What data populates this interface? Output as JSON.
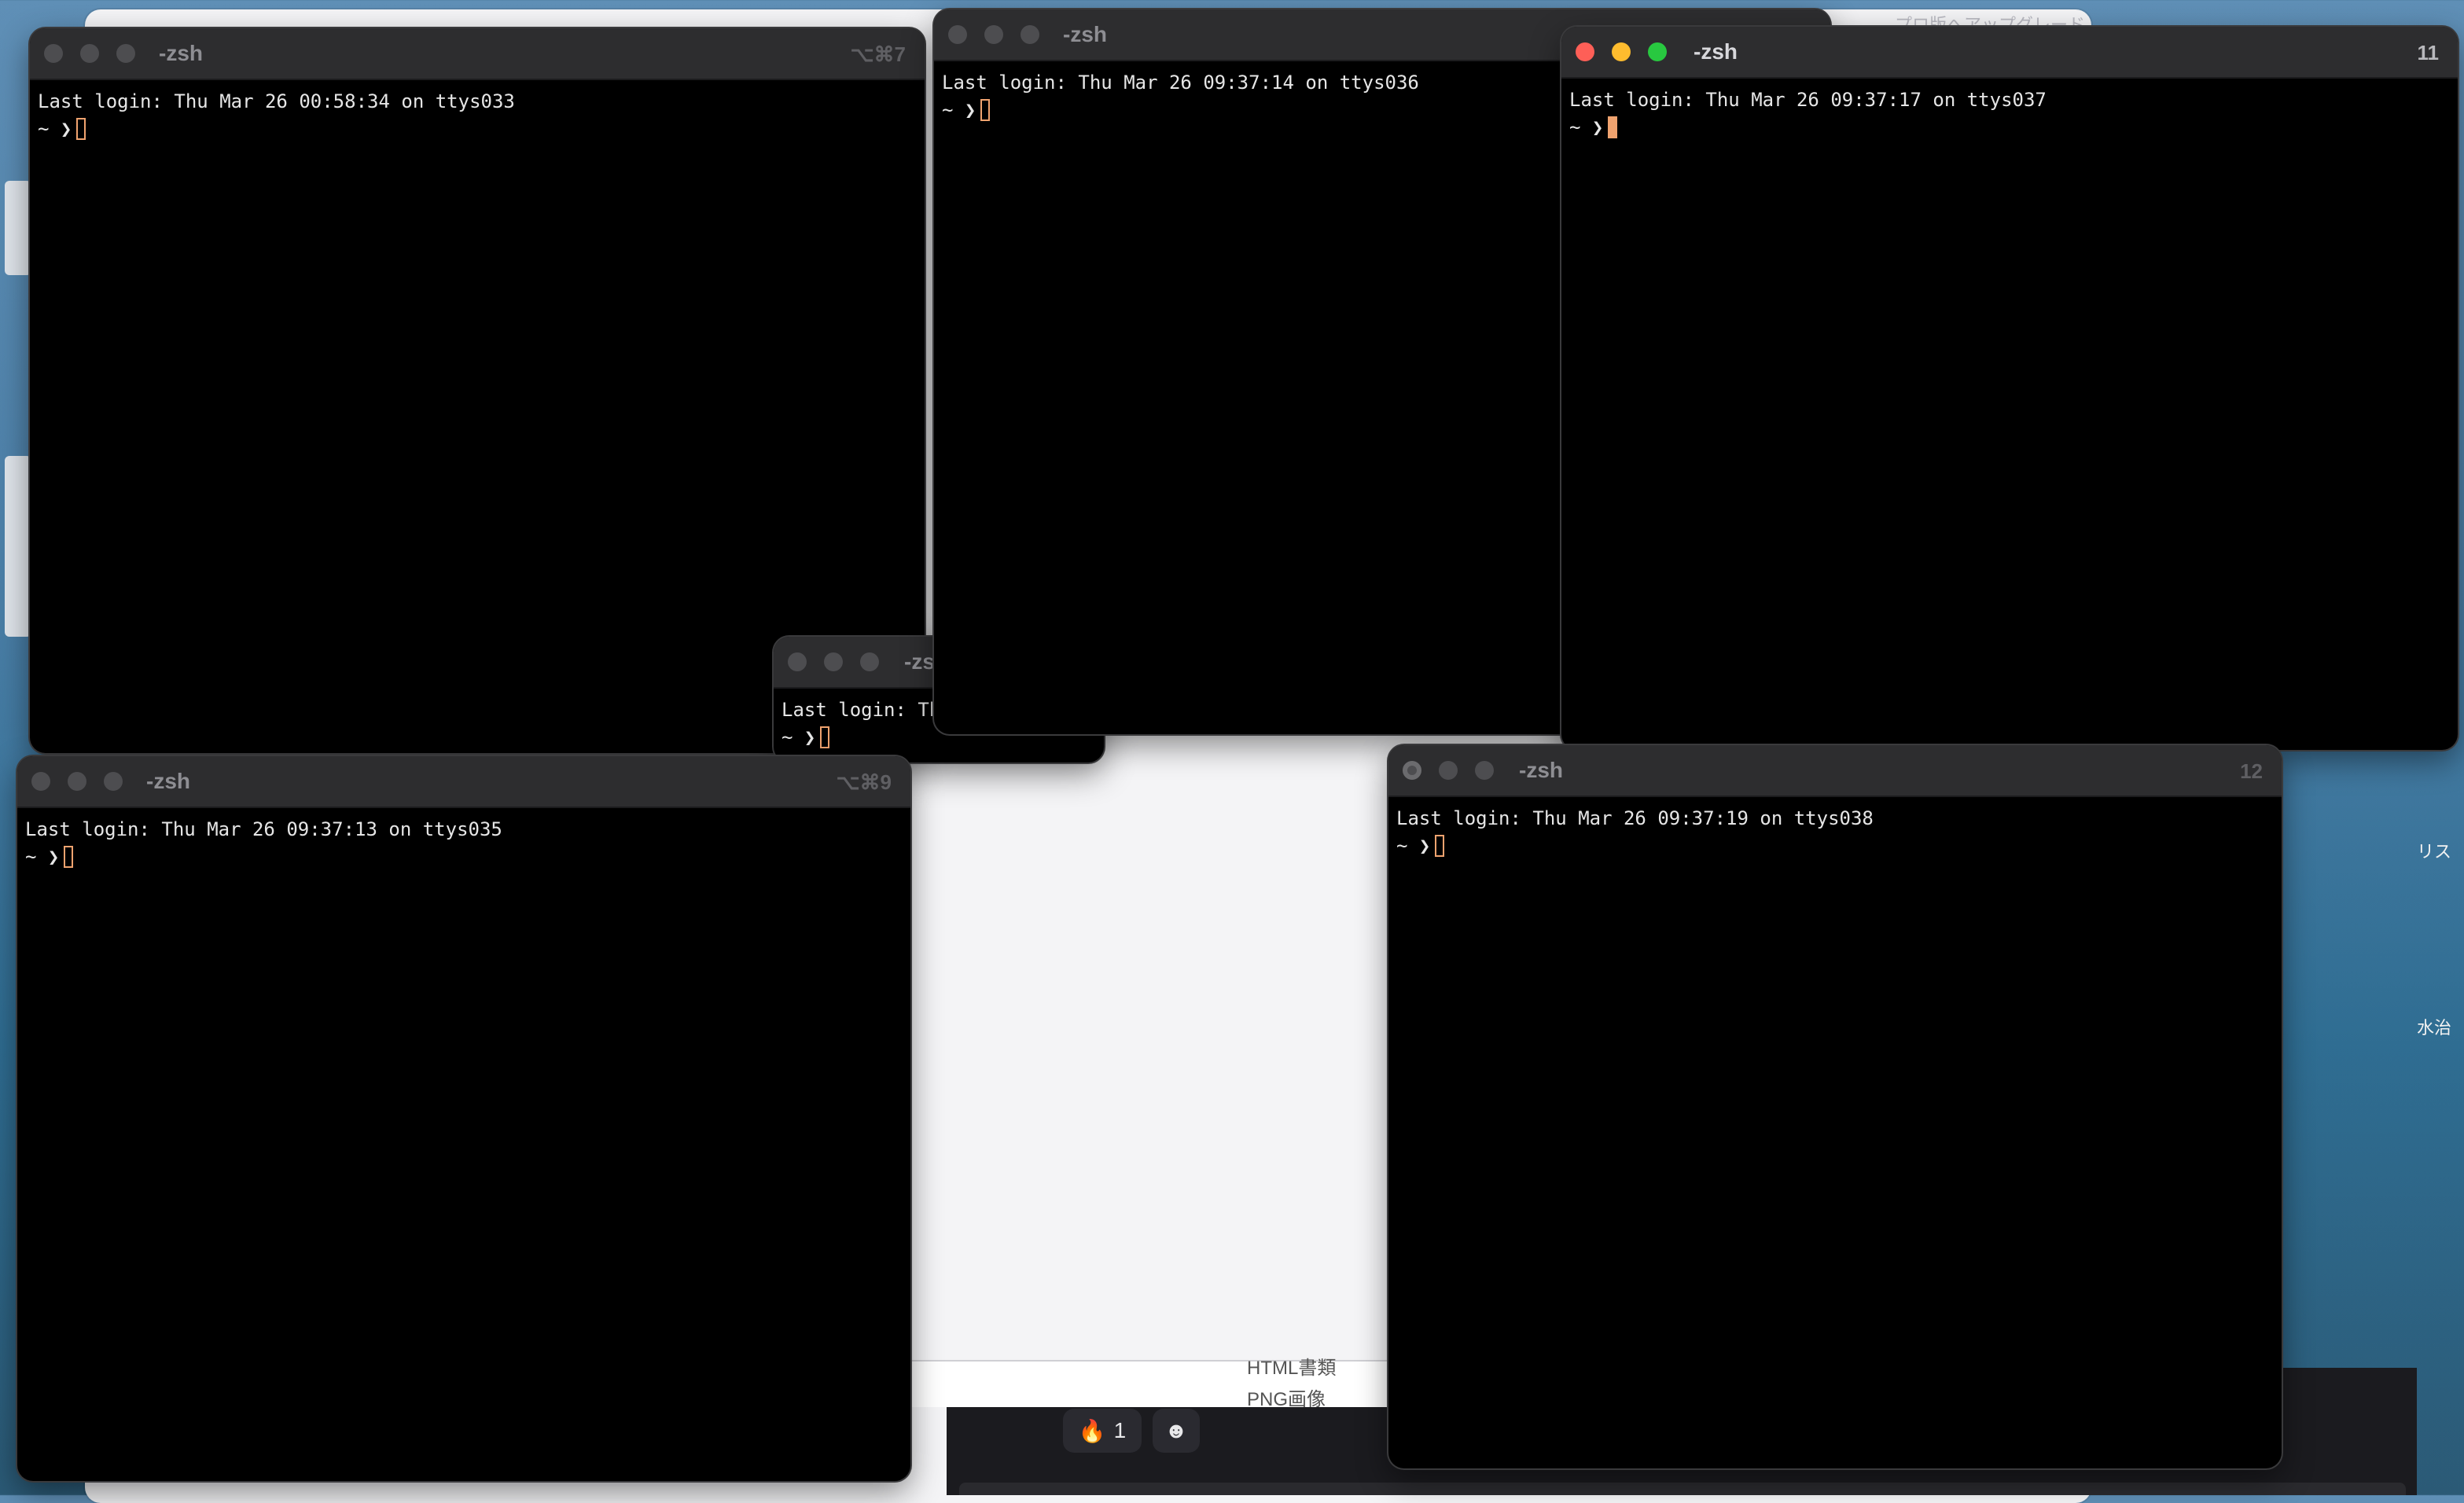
{
  "background": {
    "top_right_text": "プロ版へアップグレード",
    "file_labels": [
      "HTML書類",
      "PNG画像"
    ],
    "reactions": [
      {
        "emoji": "🔥",
        "count": "1"
      },
      {
        "emoji": "☻",
        "count": ""
      }
    ],
    "right_edge_labels": [
      "リス",
      "水治"
    ]
  },
  "terminals": [
    {
      "title": "-zsh",
      "shortcut": "⌥⌘7",
      "login": "Last login: Thu Mar 26 00:58:34 on ttys033",
      "prompt": "~ ❯"
    },
    {
      "title": "-zsh",
      "shortcut": "",
      "login": "Last login: Thu Mar 26 09:37:14 on ttys036",
      "prompt": "~ ❯"
    },
    {
      "title": "-zsh",
      "shortcut": "11",
      "login": "Last login: Thu Mar 26 09:37:17 on ttys037",
      "prompt": "~ ❯"
    },
    {
      "title": "-zs",
      "shortcut": "",
      "login": "Last login: Th",
      "prompt": "~ ❯"
    },
    {
      "title": "-zsh",
      "shortcut": "⌥⌘9",
      "login": "Last login: Thu Mar 26 09:37:13 on ttys035",
      "prompt": "~ ❯"
    },
    {
      "title": "-zsh",
      "shortcut": "12",
      "login": "Last login: Thu Mar 26 09:37:19 on ttys038",
      "prompt": "~ ❯"
    }
  ],
  "colors": {
    "close": "#fe5f57",
    "minimize": "#febc2e",
    "zoom": "#28c840",
    "cursor": "#f0a36f",
    "terminal_bg": "#000000"
  }
}
